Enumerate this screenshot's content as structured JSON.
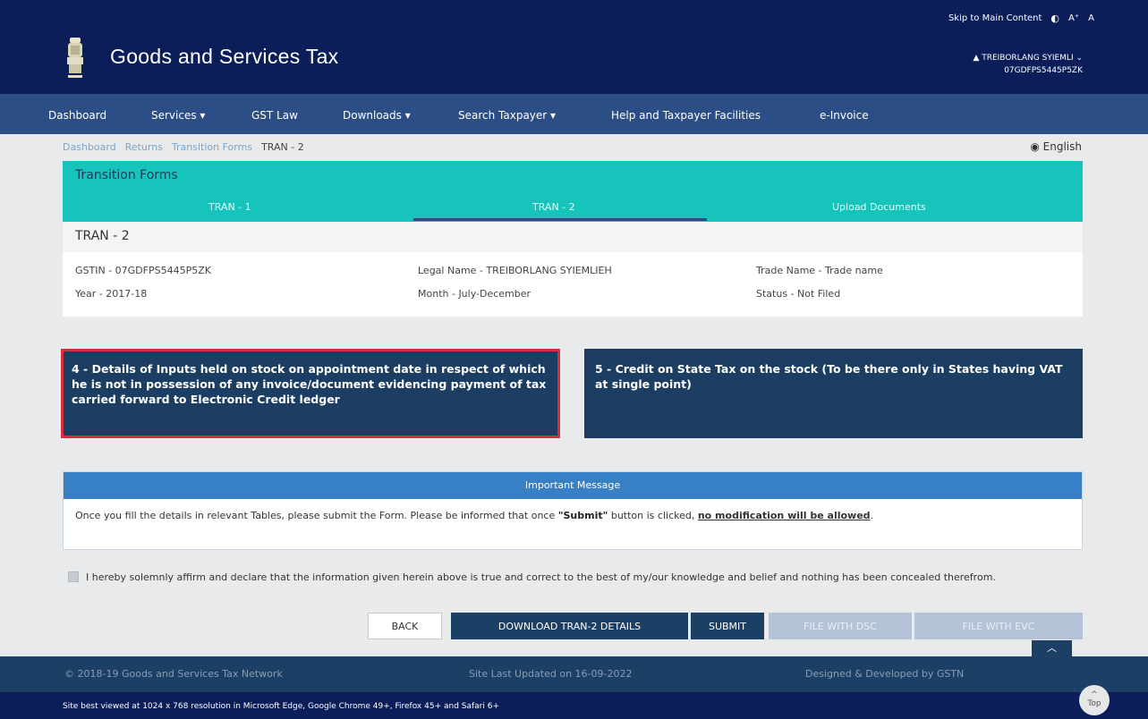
{
  "header": {
    "skip_link": "Skip to Main Content",
    "contrast_icon": "contrast-icon",
    "font_increase": "A⁺",
    "font_normal": "A",
    "title": "Goods and Services Tax",
    "user_name": "▲ TREIBORLANG SYIEMLI ⌄",
    "user_gstin": "07GDFPS5445P5ZK"
  },
  "nav": {
    "items": [
      {
        "label": "Dashboard"
      },
      {
        "label": "Services ▾"
      },
      {
        "label": "GST Law"
      },
      {
        "label": "Downloads ▾"
      },
      {
        "label": "Search Taxpayer ▾"
      },
      {
        "label": "Help and Taxpayer Facilities"
      },
      {
        "label": "e-Invoice"
      }
    ]
  },
  "breadcrumb": {
    "items": [
      "Dashboard",
      "Returns",
      "Transition Forms",
      "TRAN - 2"
    ],
    "language": "English"
  },
  "transition_forms": {
    "title": "Transition Forms",
    "tabs": [
      "TRAN - 1",
      "TRAN - 2",
      "Upload Documents"
    ],
    "active_tab": "TRAN - 2"
  },
  "form": {
    "title": "TRAN - 2",
    "gstin": "GSTIN - 07GDFPS5445P5ZK",
    "legal_name": "Legal Name - TREIBORLANG SYIEMLIEH",
    "trade_name": "Trade Name - Trade name",
    "year": "Year - 2017-18",
    "month": "Month - July-December",
    "status": "Status - Not Filed"
  },
  "tiles": [
    {
      "label": "4 - Details of Inputs held on stock on appointment date in respect of which he is not in possession of any invoice/document evidencing payment of tax carried forward to Electronic Credit ledger",
      "selected": true
    },
    {
      "label": "5 - Credit on State Tax on the stock (To be there only in States having VAT at single point)",
      "selected": false
    }
  ],
  "important_message": {
    "title": "Important Message",
    "text_1": "Once you fill the details in relevant Tables, please submit the Form. Please be informed that once ",
    "text_bold": "\"Submit\"",
    "text_2": " button is clicked, ",
    "text_emph": "no modification will be allowed",
    "text_end": "."
  },
  "declaration": "I hereby solemnly affirm and declare that the information given herein above is true and correct to the best of my/our knowledge and belief and nothing has been concealed therefrom.",
  "buttons": {
    "back": "BACK",
    "download": "DOWNLOAD TRAN-2 DETAILS",
    "submit": "SUBMIT",
    "file_dsc": "FILE WITH DSC",
    "file_evc": "FILE WITH EVC"
  },
  "footer": {
    "copyright": "© 2018-19 Goods and Services Tax Network",
    "updated": "Site Last Updated on 16-09-2022",
    "designed": "Designed & Developed by GSTN",
    "browser_note": "Site best viewed at 1024 x 768 resolution in Microsoft Edge, Google Chrome 49+, Firefox 45+ and Safari 6+",
    "top_label": "Top"
  },
  "colors": {
    "header_bg": "#0b1e59",
    "nav_bg": "#2c4e86",
    "teal": "#17c4bb",
    "tile_bg": "#1b3e62",
    "selected_border": "#d6303a",
    "message_head": "#3880c5"
  }
}
